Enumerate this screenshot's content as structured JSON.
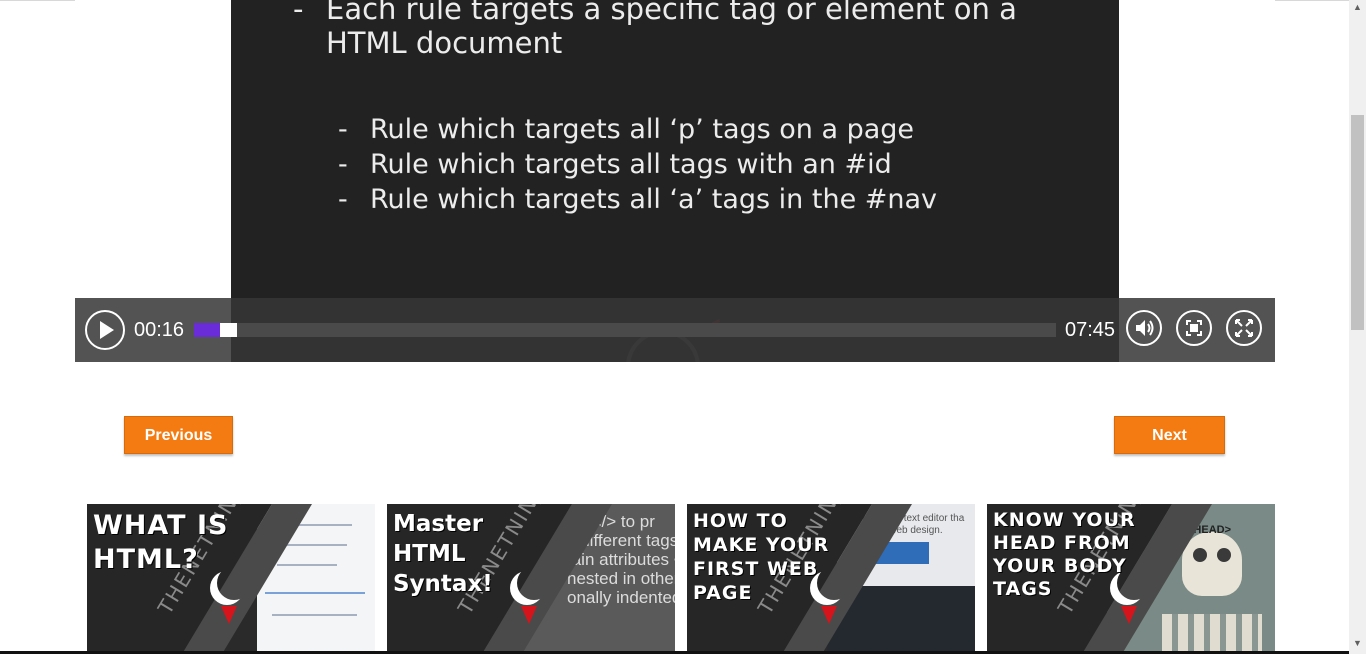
{
  "slide": {
    "bullet_main": "Each rule targets a specific tag or element on a HTML document",
    "sub_bullets": [
      "Rule which targets all ‘p’ tags on a page",
      "Rule which targets all tags with an #id",
      "Rule which targets all ‘a’ tags in the #nav"
    ]
  },
  "player": {
    "current_time": "00:16",
    "total_time": "07:45",
    "progress_fraction": 0.03,
    "buffered_fraction": 0.05,
    "accent_color": "#6a2bd8",
    "icons": [
      "play-icon",
      "volume-icon",
      "fit-screen-icon",
      "fullscreen-icon"
    ]
  },
  "navigation": {
    "previous_label": "Previous",
    "next_label": "Next",
    "button_color": "#f47a12"
  },
  "thumbnails": [
    {
      "title_lines": [
        "WHAT IS",
        "HTML?"
      ],
      "watermark": "THENETNINJA"
    },
    {
      "title_lines": [
        "Master",
        "HTML",
        "Syntax!"
      ],
      "watermark": "THENETNINJA",
      "bg_text": [
        "<> </> to pr",
        "y different tags",
        "tain attributes <",
        "nested in other ta",
        "onally indented w"
      ]
    },
    {
      "title_lines": [
        "HOW TO",
        "MAKE YOUR",
        "FIRST WEB",
        "PAGE"
      ],
      "watermark": "THENETNINJA",
      "bg_text": [
        "en source text editor tha",
        "stands web design."
      ]
    },
    {
      "title_lines": [
        "KNOW YOUR",
        "HEAD FROM",
        "YOUR BODY",
        "TAGS"
      ],
      "watermark": "THENETNINJA",
      "bg_text": [
        "<HEAD>"
      ]
    }
  ]
}
